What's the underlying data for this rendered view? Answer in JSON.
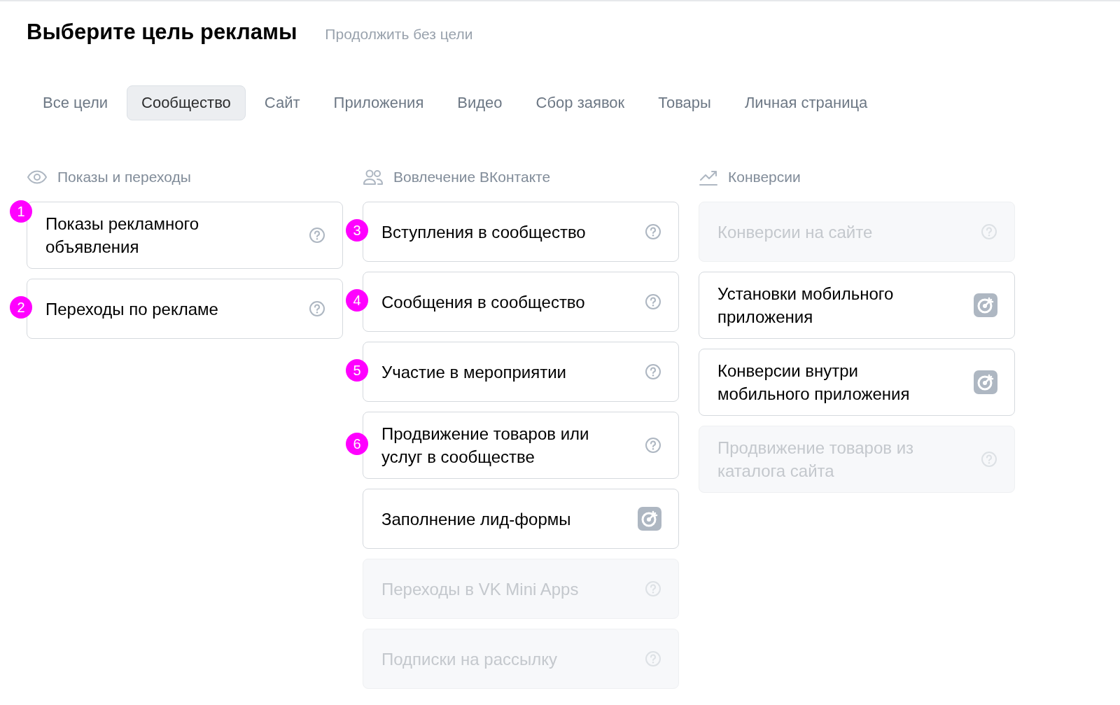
{
  "header": {
    "title": "Выберите цель рекламы",
    "link": "Продолжить без цели"
  },
  "tabs": [
    {
      "label": "Все цели",
      "selected": false
    },
    {
      "label": "Сообщество",
      "selected": true
    },
    {
      "label": "Сайт",
      "selected": false
    },
    {
      "label": "Приложения",
      "selected": false
    },
    {
      "label": "Видео",
      "selected": false
    },
    {
      "label": "Сбор заявок",
      "selected": false
    },
    {
      "label": "Товары",
      "selected": false
    },
    {
      "label": "Личная страница",
      "selected": false
    }
  ],
  "columns": [
    {
      "kind": "views",
      "title": "Показы и переходы",
      "items": [
        {
          "label": "Показы рекламного объявления",
          "disabled": false,
          "kind": "help",
          "marker": "1"
        },
        {
          "label": "Переходы по рекламе",
          "disabled": false,
          "kind": "help",
          "marker": "2"
        }
      ]
    },
    {
      "kind": "engagement",
      "title": "Вовлечение ВКонтакте",
      "items": [
        {
          "label": "Вступления в сообщество",
          "disabled": false,
          "kind": "help",
          "marker": "3"
        },
        {
          "label": "Сообщения в сообщество",
          "disabled": false,
          "kind": "help",
          "marker": "4"
        },
        {
          "label": "Участие в мероприятии",
          "disabled": false,
          "kind": "help",
          "marker": "5"
        },
        {
          "label": "Продвижение товаров или услуг в сообществе",
          "disabled": false,
          "kind": "help",
          "marker": "6"
        },
        {
          "label": "Заполнение лид-формы",
          "disabled": false,
          "kind": "target"
        },
        {
          "label": "Переходы в VK Mini Apps",
          "disabled": true,
          "kind": "help"
        },
        {
          "label": "Подписки на рассылку",
          "disabled": true,
          "kind": "help"
        }
      ]
    },
    {
      "kind": "conversions",
      "title": "Конверсии",
      "items": [
        {
          "label": "Конверсии на сайте",
          "disabled": true,
          "kind": "help"
        },
        {
          "label": "Установки мобильного приложения",
          "disabled": false,
          "kind": "target"
        },
        {
          "label": "Конверсии внутри мобильного приложения",
          "disabled": false,
          "kind": "target"
        },
        {
          "label": "Продвижение товаров из каталога сайта",
          "disabled": true,
          "kind": "help"
        }
      ]
    }
  ]
}
